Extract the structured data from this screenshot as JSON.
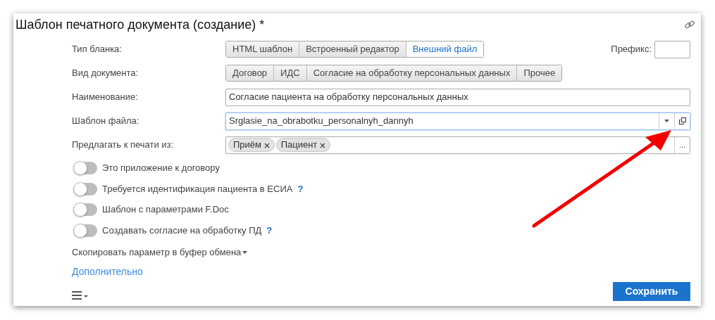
{
  "window": {
    "title": "Шаблон печатного документа (создание) *"
  },
  "form_type": {
    "label": "Тип бланка:",
    "options": [
      {
        "label": "HTML шаблон",
        "selected": false
      },
      {
        "label": "Встроенный редактор",
        "selected": false
      },
      {
        "label": "Внешний файл",
        "selected": true
      }
    ],
    "prefix": {
      "label": "Префикс:"
    }
  },
  "doc_kind": {
    "label": "Вид документа:",
    "options": [
      {
        "label": "Договор",
        "selected": false
      },
      {
        "label": "ИДС",
        "selected": false
      },
      {
        "label": "Согласие на обработку персональных данных",
        "selected": false
      },
      {
        "label": "Прочее",
        "selected": false
      }
    ]
  },
  "name": {
    "label": "Наименование:",
    "value": "Согласие пациента на обработку персональных данных"
  },
  "file_template": {
    "label": "Шаблон файла:",
    "value": "Srglasie_na_obrabotku_personalnyh_dannyh",
    "focused": true
  },
  "offer_print": {
    "label": "Предлагать к печати из:",
    "tags": [
      "Приём",
      "Пациент"
    ],
    "more": "..."
  },
  "toggles": [
    {
      "label": "Это приложение к договору",
      "on": false
    },
    {
      "label": "Требуется идентификация пациента в ЕСИА",
      "on": false,
      "help": "?"
    },
    {
      "label": "Шаблон с параметрами F.Doc",
      "on": false
    },
    {
      "label": "Создавать согласие на обработку ПД",
      "on": false,
      "help": "?"
    }
  ],
  "copy_param": {
    "label": "Скопировать параметр в буфер обмена"
  },
  "more_link": "Дополнительно",
  "save_button": "Сохранить"
}
